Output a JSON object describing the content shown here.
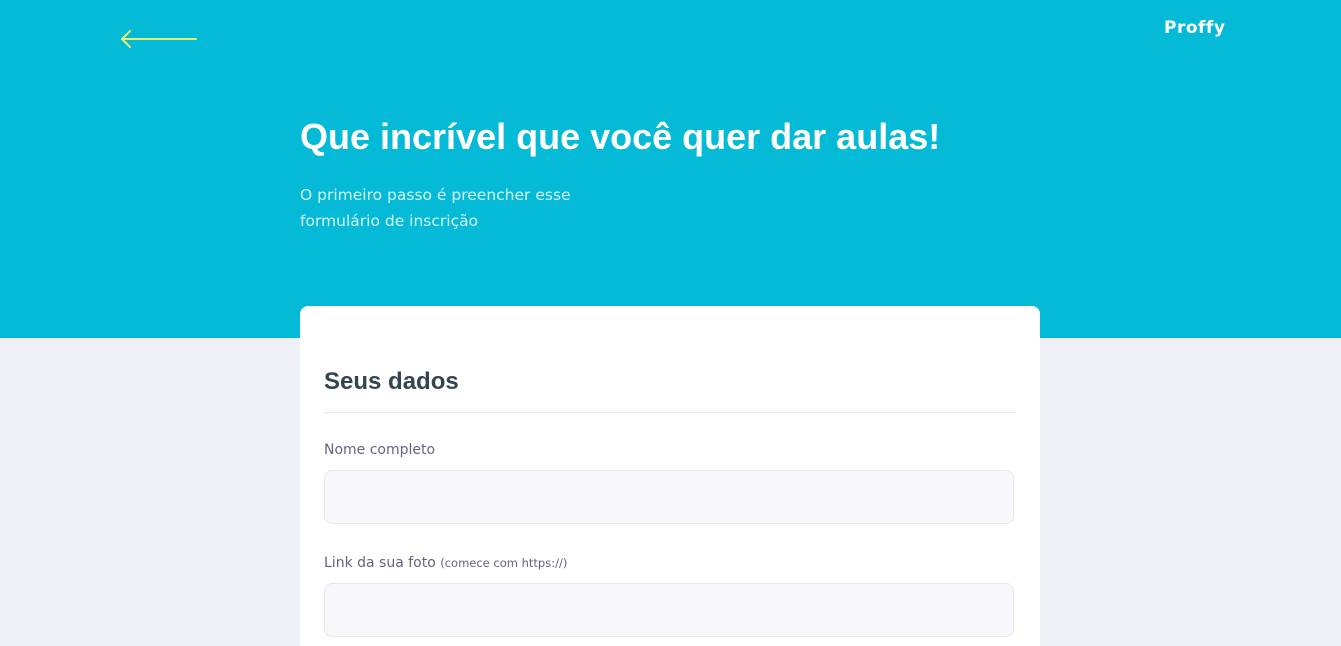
{
  "header": {
    "back_icon": "arrow-left-icon",
    "brand": "Proffy",
    "accent_color": "#04bad7",
    "arrow_color": "#e2f46f"
  },
  "hero": {
    "title": "Que incrível que você quer dar aulas!",
    "description_lines": [
      "O primeiro passo é preencher esse",
      "formulário de inscrição"
    ]
  },
  "form": {
    "section_title": "Seus dados",
    "fields": [
      {
        "label": "Nome completo",
        "hint": "",
        "value": "",
        "placeholder": ""
      },
      {
        "label": "Link da sua foto",
        "hint": "(comece com https://)",
        "value": "",
        "placeholder": ""
      }
    ]
  }
}
